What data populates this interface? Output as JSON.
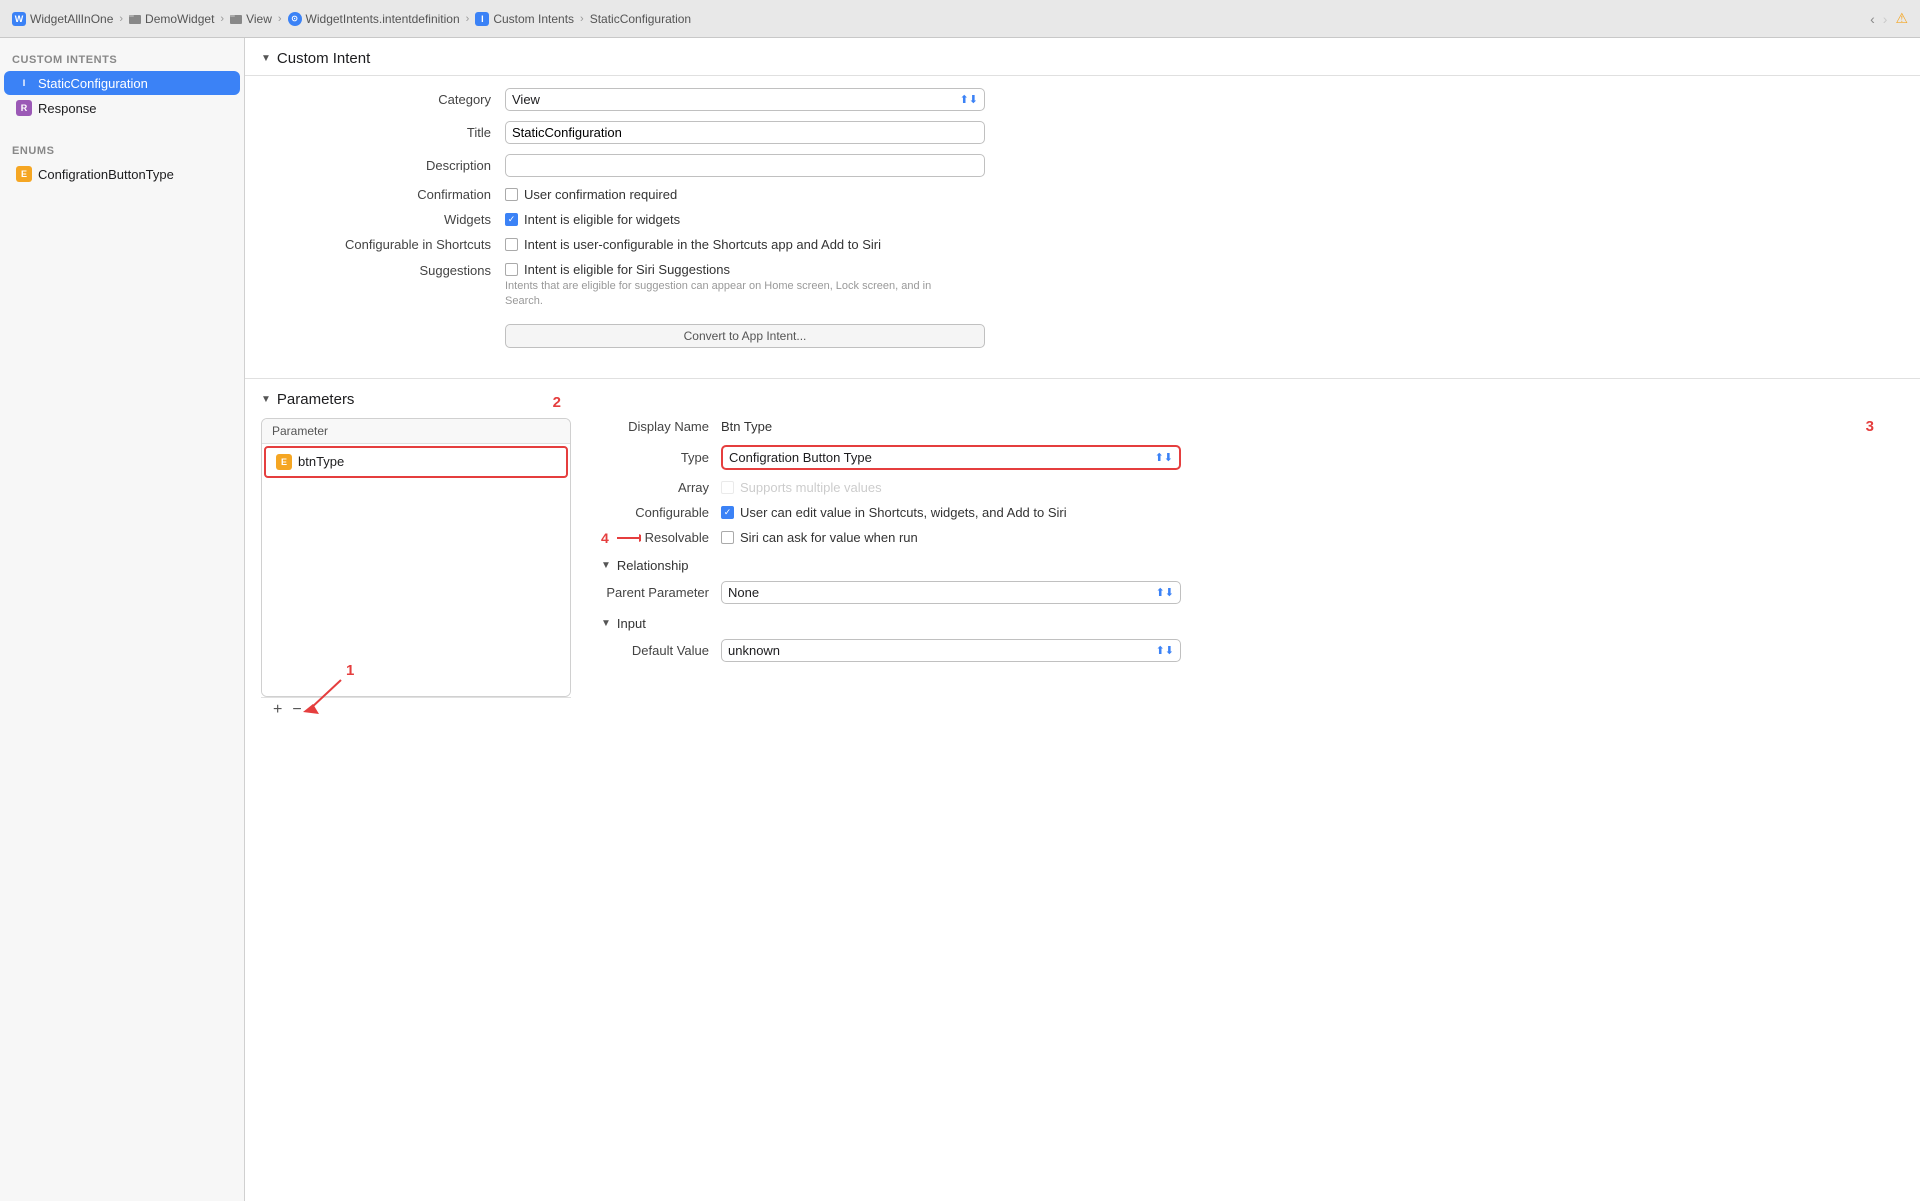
{
  "titlebar": {
    "breadcrumbs": [
      {
        "label": "WidgetAllInOne",
        "icon": "",
        "type": "app"
      },
      {
        "label": "DemoWidget",
        "icon": "folder",
        "type": "folder"
      },
      {
        "label": "View",
        "icon": "folder",
        "type": "folder"
      },
      {
        "label": "WidgetIntents.intentdefinition",
        "icon": "intent",
        "type": "file"
      },
      {
        "label": "Custom Intents",
        "icon": "intent-i",
        "type": "intent"
      },
      {
        "label": "StaticConfiguration",
        "icon": "",
        "type": "none"
      }
    ]
  },
  "sidebar": {
    "custom_intents_label": "CUSTOM INTENTS",
    "enums_label": "ENUMS",
    "items": [
      {
        "label": "StaticConfiguration",
        "badge": "I",
        "badge_type": "intent-blue",
        "active": true
      },
      {
        "label": "Response",
        "badge": "R",
        "badge_type": "purple",
        "active": false
      }
    ],
    "enums": [
      {
        "label": "ConfigrationButtonType",
        "badge": "E",
        "badge_type": "orange",
        "active": false
      }
    ]
  },
  "custom_intent": {
    "section_title": "Custom Intent",
    "fields": {
      "category_label": "Category",
      "category_value": "View",
      "title_label": "Title",
      "title_value": "StaticConfiguration",
      "description_label": "Description",
      "description_value": "",
      "description_placeholder": "",
      "confirmation_label": "Confirmation",
      "confirmation_text": "User confirmation required",
      "confirmation_checked": false,
      "widgets_label": "Widgets",
      "widgets_text": "Intent is eligible for widgets",
      "widgets_checked": true,
      "configurable_label": "Configurable in Shortcuts",
      "configurable_text": "Intent is user-configurable in the Shortcuts app and Add to Siri",
      "configurable_checked": false,
      "suggestions_label": "Suggestions",
      "suggestions_text": "Intent is eligible for Siri Suggestions",
      "suggestions_checked": false,
      "suggestions_hint": "Intents that are eligible for suggestion can appear on Home screen, Lock screen, and in Search.",
      "convert_btn": "Convert to App Intent..."
    }
  },
  "parameters": {
    "section_title": "Parameters",
    "list": {
      "header": "Parameter",
      "items": [
        {
          "label": "btnType",
          "badge": "E",
          "badge_type": "orange"
        }
      ],
      "add_btn": "+",
      "remove_btn": "−"
    },
    "detail": {
      "display_name_label": "Display Name",
      "display_name_value": "Btn Type",
      "type_label": "Type",
      "type_value": "Configration Button Type",
      "array_label": "Array",
      "array_text": "Supports multiple values",
      "array_checked": false,
      "array_disabled": true,
      "configurable_label": "Configurable",
      "configurable_text": "User can edit value in Shortcuts, widgets, and Add to Siri",
      "configurable_checked": true,
      "resolvable_label": "Resolvable",
      "resolvable_text": "Siri can ask for value when run",
      "resolvable_checked": false,
      "relationship_title": "Relationship",
      "parent_param_label": "Parent Parameter",
      "parent_param_value": "None",
      "input_title": "Input",
      "default_value_label": "Default Value",
      "default_value_value": "unknown"
    },
    "annotations": {
      "one": "1",
      "two": "2",
      "three": "3",
      "four": "4"
    }
  }
}
